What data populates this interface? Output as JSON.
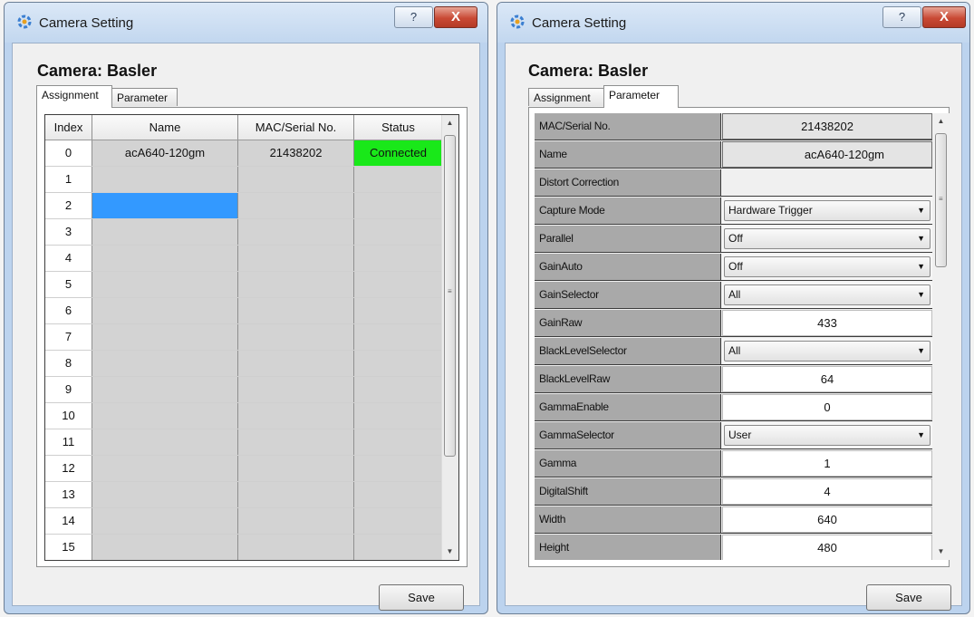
{
  "left_window": {
    "title": "Camera Setting",
    "help_label": "?",
    "close_label": "X",
    "camera_label": "Camera: Basler",
    "tabs": [
      {
        "label": "Assignment",
        "active": true
      },
      {
        "label": "Parameter",
        "active": false
      }
    ],
    "table": {
      "columns": [
        "Index",
        "Name",
        "MAC/Serial No.",
        "Status"
      ],
      "rows": [
        {
          "index": "0",
          "name": "acA640-120gm",
          "mac": "21438202",
          "status": "Connected"
        },
        {
          "index": "1",
          "name": "",
          "mac": "",
          "status": ""
        },
        {
          "index": "2",
          "name": "",
          "mac": "",
          "status": ""
        },
        {
          "index": "3",
          "name": "",
          "mac": "",
          "status": ""
        },
        {
          "index": "4",
          "name": "",
          "mac": "",
          "status": ""
        },
        {
          "index": "5",
          "name": "",
          "mac": "",
          "status": ""
        },
        {
          "index": "6",
          "name": "",
          "mac": "",
          "status": ""
        },
        {
          "index": "7",
          "name": "",
          "mac": "",
          "status": ""
        },
        {
          "index": "8",
          "name": "",
          "mac": "",
          "status": ""
        },
        {
          "index": "9",
          "name": "",
          "mac": "",
          "status": ""
        },
        {
          "index": "10",
          "name": "",
          "mac": "",
          "status": ""
        },
        {
          "index": "11",
          "name": "",
          "mac": "",
          "status": ""
        },
        {
          "index": "12",
          "name": "",
          "mac": "",
          "status": ""
        },
        {
          "index": "13",
          "name": "",
          "mac": "",
          "status": ""
        },
        {
          "index": "14",
          "name": "",
          "mac": "",
          "status": ""
        },
        {
          "index": "15",
          "name": "",
          "mac": "",
          "status": ""
        }
      ],
      "selected_row_index": "2",
      "connected_color": "#19e819",
      "selection_color": "#3399ff"
    },
    "save_label": "Save"
  },
  "right_window": {
    "title": "Camera Setting",
    "help_label": "?",
    "close_label": "X",
    "camera_label": "Camera: Basler",
    "tabs": [
      {
        "label": "Assignment",
        "active": false
      },
      {
        "label": "Parameter",
        "active": true
      }
    ],
    "parameters": [
      {
        "name": "MAC/Serial No.",
        "value": "21438202",
        "kind": "readonly"
      },
      {
        "name": "Name",
        "value": "acA640-120gm",
        "kind": "readonly"
      },
      {
        "name": "Distort Correction",
        "value": "",
        "kind": "empty"
      },
      {
        "name": "Capture Mode",
        "value": "Hardware Trigger",
        "kind": "dropdown"
      },
      {
        "name": "Parallel",
        "value": "Off",
        "kind": "dropdown"
      },
      {
        "name": "GainAuto",
        "value": "Off",
        "kind": "dropdown"
      },
      {
        "name": "GainSelector",
        "value": "All",
        "kind": "dropdown"
      },
      {
        "name": "GainRaw",
        "value": "433",
        "kind": "text"
      },
      {
        "name": "BlackLevelSelector",
        "value": "All",
        "kind": "dropdown"
      },
      {
        "name": "BlackLevelRaw",
        "value": "64",
        "kind": "text"
      },
      {
        "name": "GammaEnable",
        "value": "0",
        "kind": "text"
      },
      {
        "name": "GammaSelector",
        "value": "User",
        "kind": "dropdown"
      },
      {
        "name": "Gamma",
        "value": "1",
        "kind": "text"
      },
      {
        "name": "DigitalShift",
        "value": "4",
        "kind": "text"
      },
      {
        "name": "Width",
        "value": "640",
        "kind": "text"
      },
      {
        "name": "Height",
        "value": "480",
        "kind": "text"
      }
    ],
    "save_label": "Save"
  }
}
